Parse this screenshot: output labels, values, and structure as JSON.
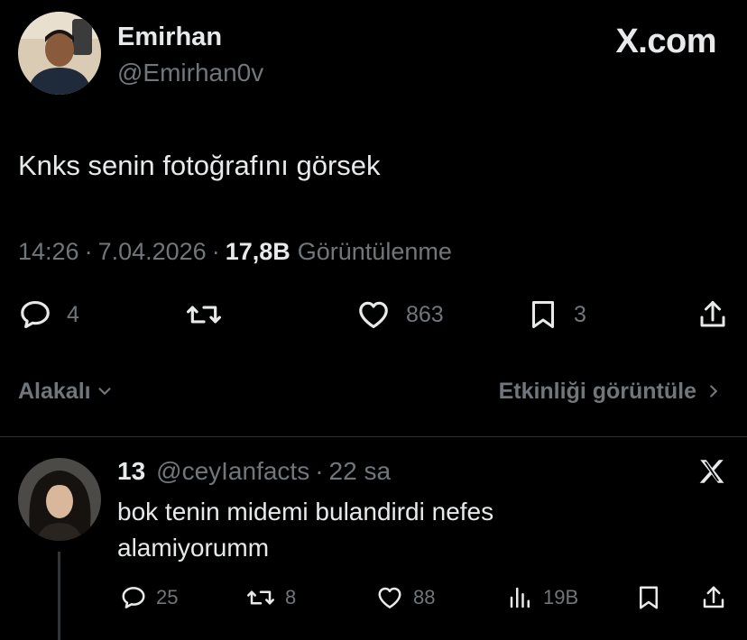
{
  "brand": {
    "label": "X.com"
  },
  "tweet": {
    "author_name": "Emirhan",
    "author_handle": "@Emirhan0v",
    "text": "Knks senin fotoğrafını görsek",
    "time": "14:26",
    "date": "7.04.2026",
    "views_count": "17,8B",
    "views_label": "Görüntülenme",
    "actions": {
      "replies": "4",
      "likes": "863",
      "bookmarks": "3"
    }
  },
  "filters": {
    "sort_label": "Alakalı",
    "activity_label": "Etkinliği görüntüle"
  },
  "reply": {
    "author_name": "13",
    "author_handle": "@ceyIanfacts",
    "time": "22 sa",
    "text": "bok tenin midemi bulandirdi nefes alamiyorumm",
    "actions": {
      "replies": "25",
      "reposts": "8",
      "likes": "88",
      "views": "19B"
    }
  },
  "icons": {
    "reply": "speech-bubble-icon",
    "repost": "repost-arrows-icon",
    "like": "heart-icon",
    "bookmark": "bookmark-icon",
    "share": "share-upload-icon",
    "views": "bar-chart-icon",
    "chevron_down": "chevron-down-icon",
    "chevron_right": "chevron-right-icon",
    "x_logo": "x-logo-icon"
  },
  "colors": {
    "background": "#000000",
    "primary_text": "#e7e9ea",
    "secondary_text": "#71767b",
    "divider": "#2f3336"
  }
}
